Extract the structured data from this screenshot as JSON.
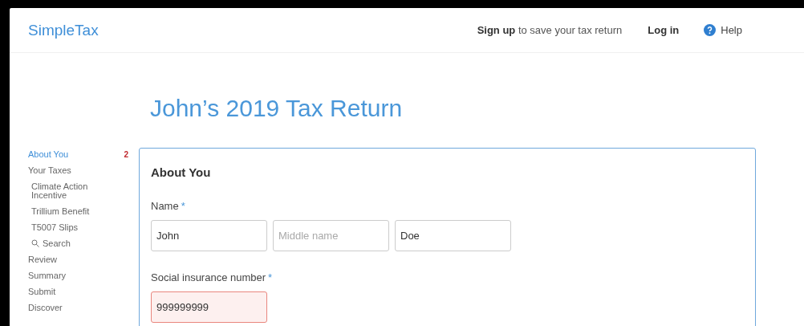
{
  "app": {
    "name": "SimpleTax"
  },
  "header": {
    "signup_prompt": "**Sign up** to save your tax return",
    "login": "Log in",
    "help": "Help"
  },
  "page_title": "John’s 2019 Tax Return",
  "sidebar": {
    "items": [
      {
        "kind": "link",
        "label": "About You",
        "selected": true,
        "badge": "2"
      },
      {
        "kind": "link",
        "label": "Your Taxes",
        "selected": false,
        "children": [
          {
            "kind": "link",
            "label": "Climate Action Incentive",
            "selected": false
          },
          {
            "kind": "link",
            "label": "Trillium Benefit",
            "selected": false
          },
          {
            "kind": "link",
            "label": "T5007 Slips",
            "selected": false
          },
          {
            "kind": "search",
            "label": "Search",
            "selected": false
          }
        ]
      },
      {
        "kind": "link",
        "label": "Review",
        "selected": false
      },
      {
        "kind": "link",
        "label": "Summary",
        "selected": false
      },
      {
        "kind": "link",
        "label": "Submit",
        "selected": false
      },
      {
        "kind": "link",
        "label": "Discover",
        "selected": false
      }
    ]
  },
  "form": {
    "title": "About You",
    "fields": [
      {
        "label": "Name",
        "required_mark": "*",
        "error": false,
        "inputs": [
          {
            "value": "John"
          },
          {
            "placeholder": "Middle name"
          },
          {
            "value": "Doe"
          }
        ]
      },
      {
        "label": "Social insurance number",
        "required_mark": "*",
        "error": true,
        "inputs": [
          {
            "value": "999999999"
          }
        ]
      }
    ]
  }
}
